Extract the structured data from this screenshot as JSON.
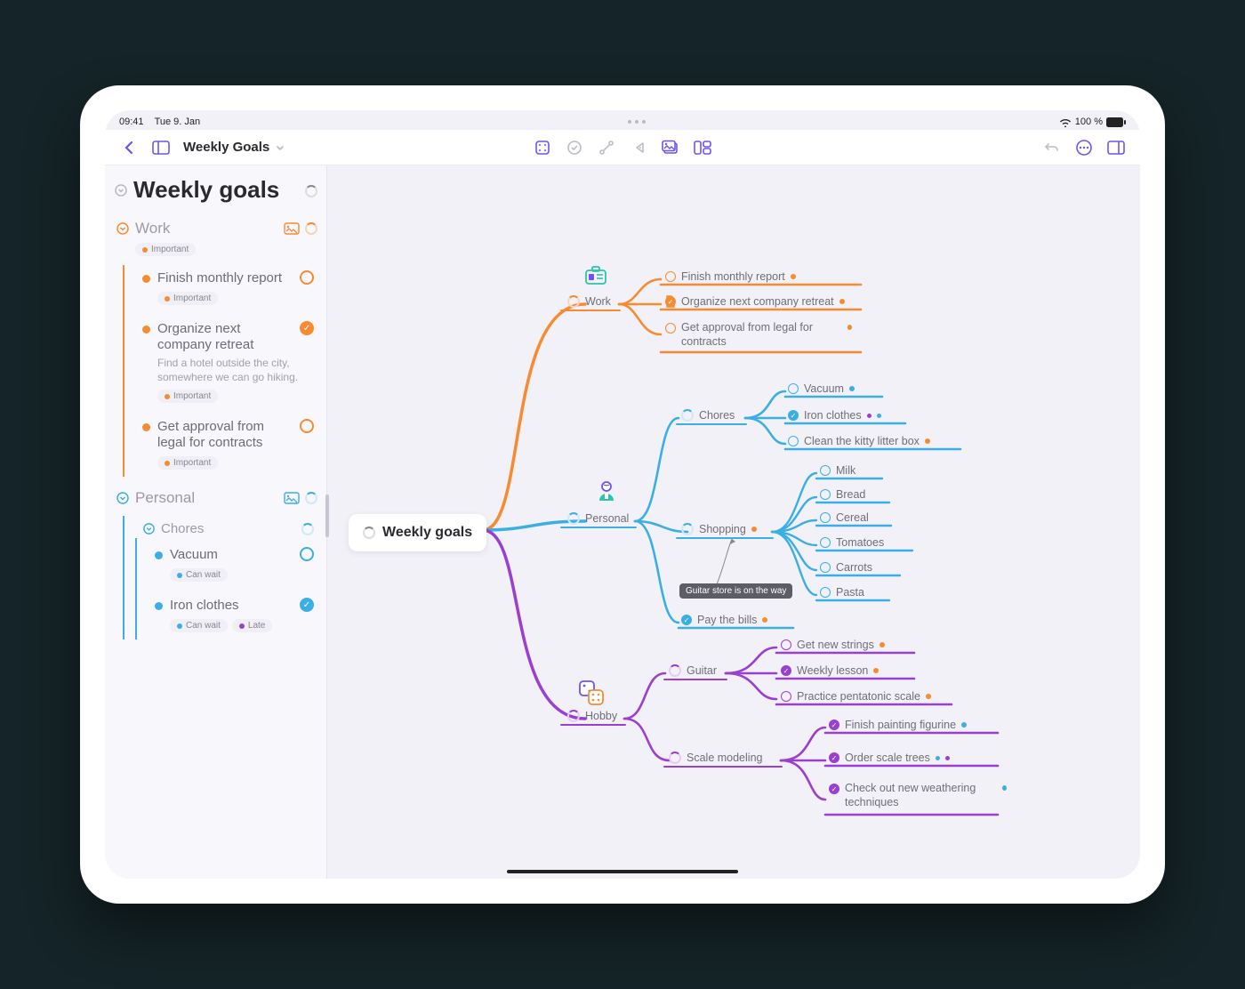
{
  "status": {
    "time": "09:41",
    "date": "Tue 9. Jan",
    "battery": "100 %"
  },
  "toolbar": {
    "title": "Weekly Goals"
  },
  "colors": {
    "orange": "#f78b32",
    "blue": "#3baee4",
    "purple": "#9a3fcf",
    "accent": "#6d53f0"
  },
  "sidebar": {
    "root_title": "Weekly goals",
    "sections": [
      {
        "id": "work",
        "title": "Work",
        "color": "#f78b32",
        "tag": "Important",
        "items": [
          {
            "title": "Finish monthly report",
            "status": "open",
            "tags": [
              "Important"
            ]
          },
          {
            "title": "Organize next company retreat",
            "status": "done",
            "note": "Find a hotel outside the city, somewhere we can go hiking.",
            "tags": [
              "Important"
            ]
          },
          {
            "title": "Get approval from legal for contracts",
            "status": "open",
            "tags": [
              "Important"
            ]
          }
        ]
      },
      {
        "id": "personal",
        "title": "Personal",
        "color": "#3baee4",
        "sub": {
          "title": "Chores",
          "items": [
            {
              "title": "Vacuum",
              "status": "open",
              "tags": [
                {
                  "label": "Can wait",
                  "color": "#3baee4"
                }
              ]
            },
            {
              "title": "Iron clothes",
              "status": "done",
              "tags": [
                {
                  "label": "Can wait",
                  "color": "#3baee4"
                },
                {
                  "label": "Late",
                  "color": "#9a3fcf"
                }
              ]
            }
          ]
        }
      }
    ]
  },
  "mindmap": {
    "root": "Weekly goals",
    "tooltip": "Guitar store is on the way",
    "branches": [
      {
        "id": "work",
        "label": "Work",
        "color": "#f78b32",
        "icon": "id-card",
        "children": [
          {
            "label": "Finish monthly report",
            "status": "open",
            "dots": [
              "#f78b32"
            ]
          },
          {
            "label": "Organize next company retreat",
            "status": "done",
            "dots": [
              "#f78b32"
            ],
            "attach": "doc"
          },
          {
            "label": "Get approval from legal for contracts",
            "status": "open",
            "dots": [
              "#f78b32"
            ],
            "wrap": true
          }
        ]
      },
      {
        "id": "personal",
        "label": "Personal",
        "color": "#3baee4",
        "icon": "person",
        "children": [
          {
            "label": "Chores",
            "kind": "branch",
            "children": [
              {
                "label": "Vacuum",
                "status": "open",
                "dots": [
                  "#3baee4"
                ]
              },
              {
                "label": "Iron clothes",
                "status": "done",
                "dots": [
                  "#9a3fcf",
                  "#3baee4"
                ]
              },
              {
                "label": "Clean the kitty litter box",
                "status": "open",
                "dots": [
                  "#f78b32"
                ]
              }
            ]
          },
          {
            "label": "Shopping",
            "kind": "branch",
            "dots": [
              "#f78b32"
            ],
            "children": [
              {
                "label": "Milk",
                "status": "open"
              },
              {
                "label": "Bread",
                "status": "open"
              },
              {
                "label": "Cereal",
                "status": "open"
              },
              {
                "label": "Tomatoes",
                "status": "open"
              },
              {
                "label": "Carrots",
                "status": "open"
              },
              {
                "label": "Pasta",
                "status": "open"
              }
            ]
          },
          {
            "label": "Pay the bills",
            "status": "done",
            "dots": [
              "#f78b32"
            ]
          }
        ]
      },
      {
        "id": "hobby",
        "label": "Hobby",
        "color": "#9a3fcf",
        "icon": "dice",
        "children": [
          {
            "label": "Guitar",
            "kind": "branch",
            "children": [
              {
                "label": "Get new strings",
                "status": "open",
                "dots": [
                  "#f78b32"
                ]
              },
              {
                "label": "Weekly lesson",
                "status": "done",
                "dots": [
                  "#f78b32"
                ]
              },
              {
                "label": "Practice pentatonic scale",
                "status": "open",
                "dots": [
                  "#f78b32"
                ]
              }
            ]
          },
          {
            "label": "Scale modeling",
            "kind": "branch",
            "children": [
              {
                "label": "Finish painting figurine",
                "status": "done",
                "dots": [
                  "#3baee4"
                ]
              },
              {
                "label": "Order scale trees",
                "status": "done",
                "dots": [
                  "#3baee4",
                  "#9a3fcf"
                ]
              },
              {
                "label": "Check out new weathering techniques",
                "status": "done",
                "dots": [
                  "#3baee4"
                ],
                "wrap": true
              }
            ]
          }
        ]
      }
    ]
  }
}
